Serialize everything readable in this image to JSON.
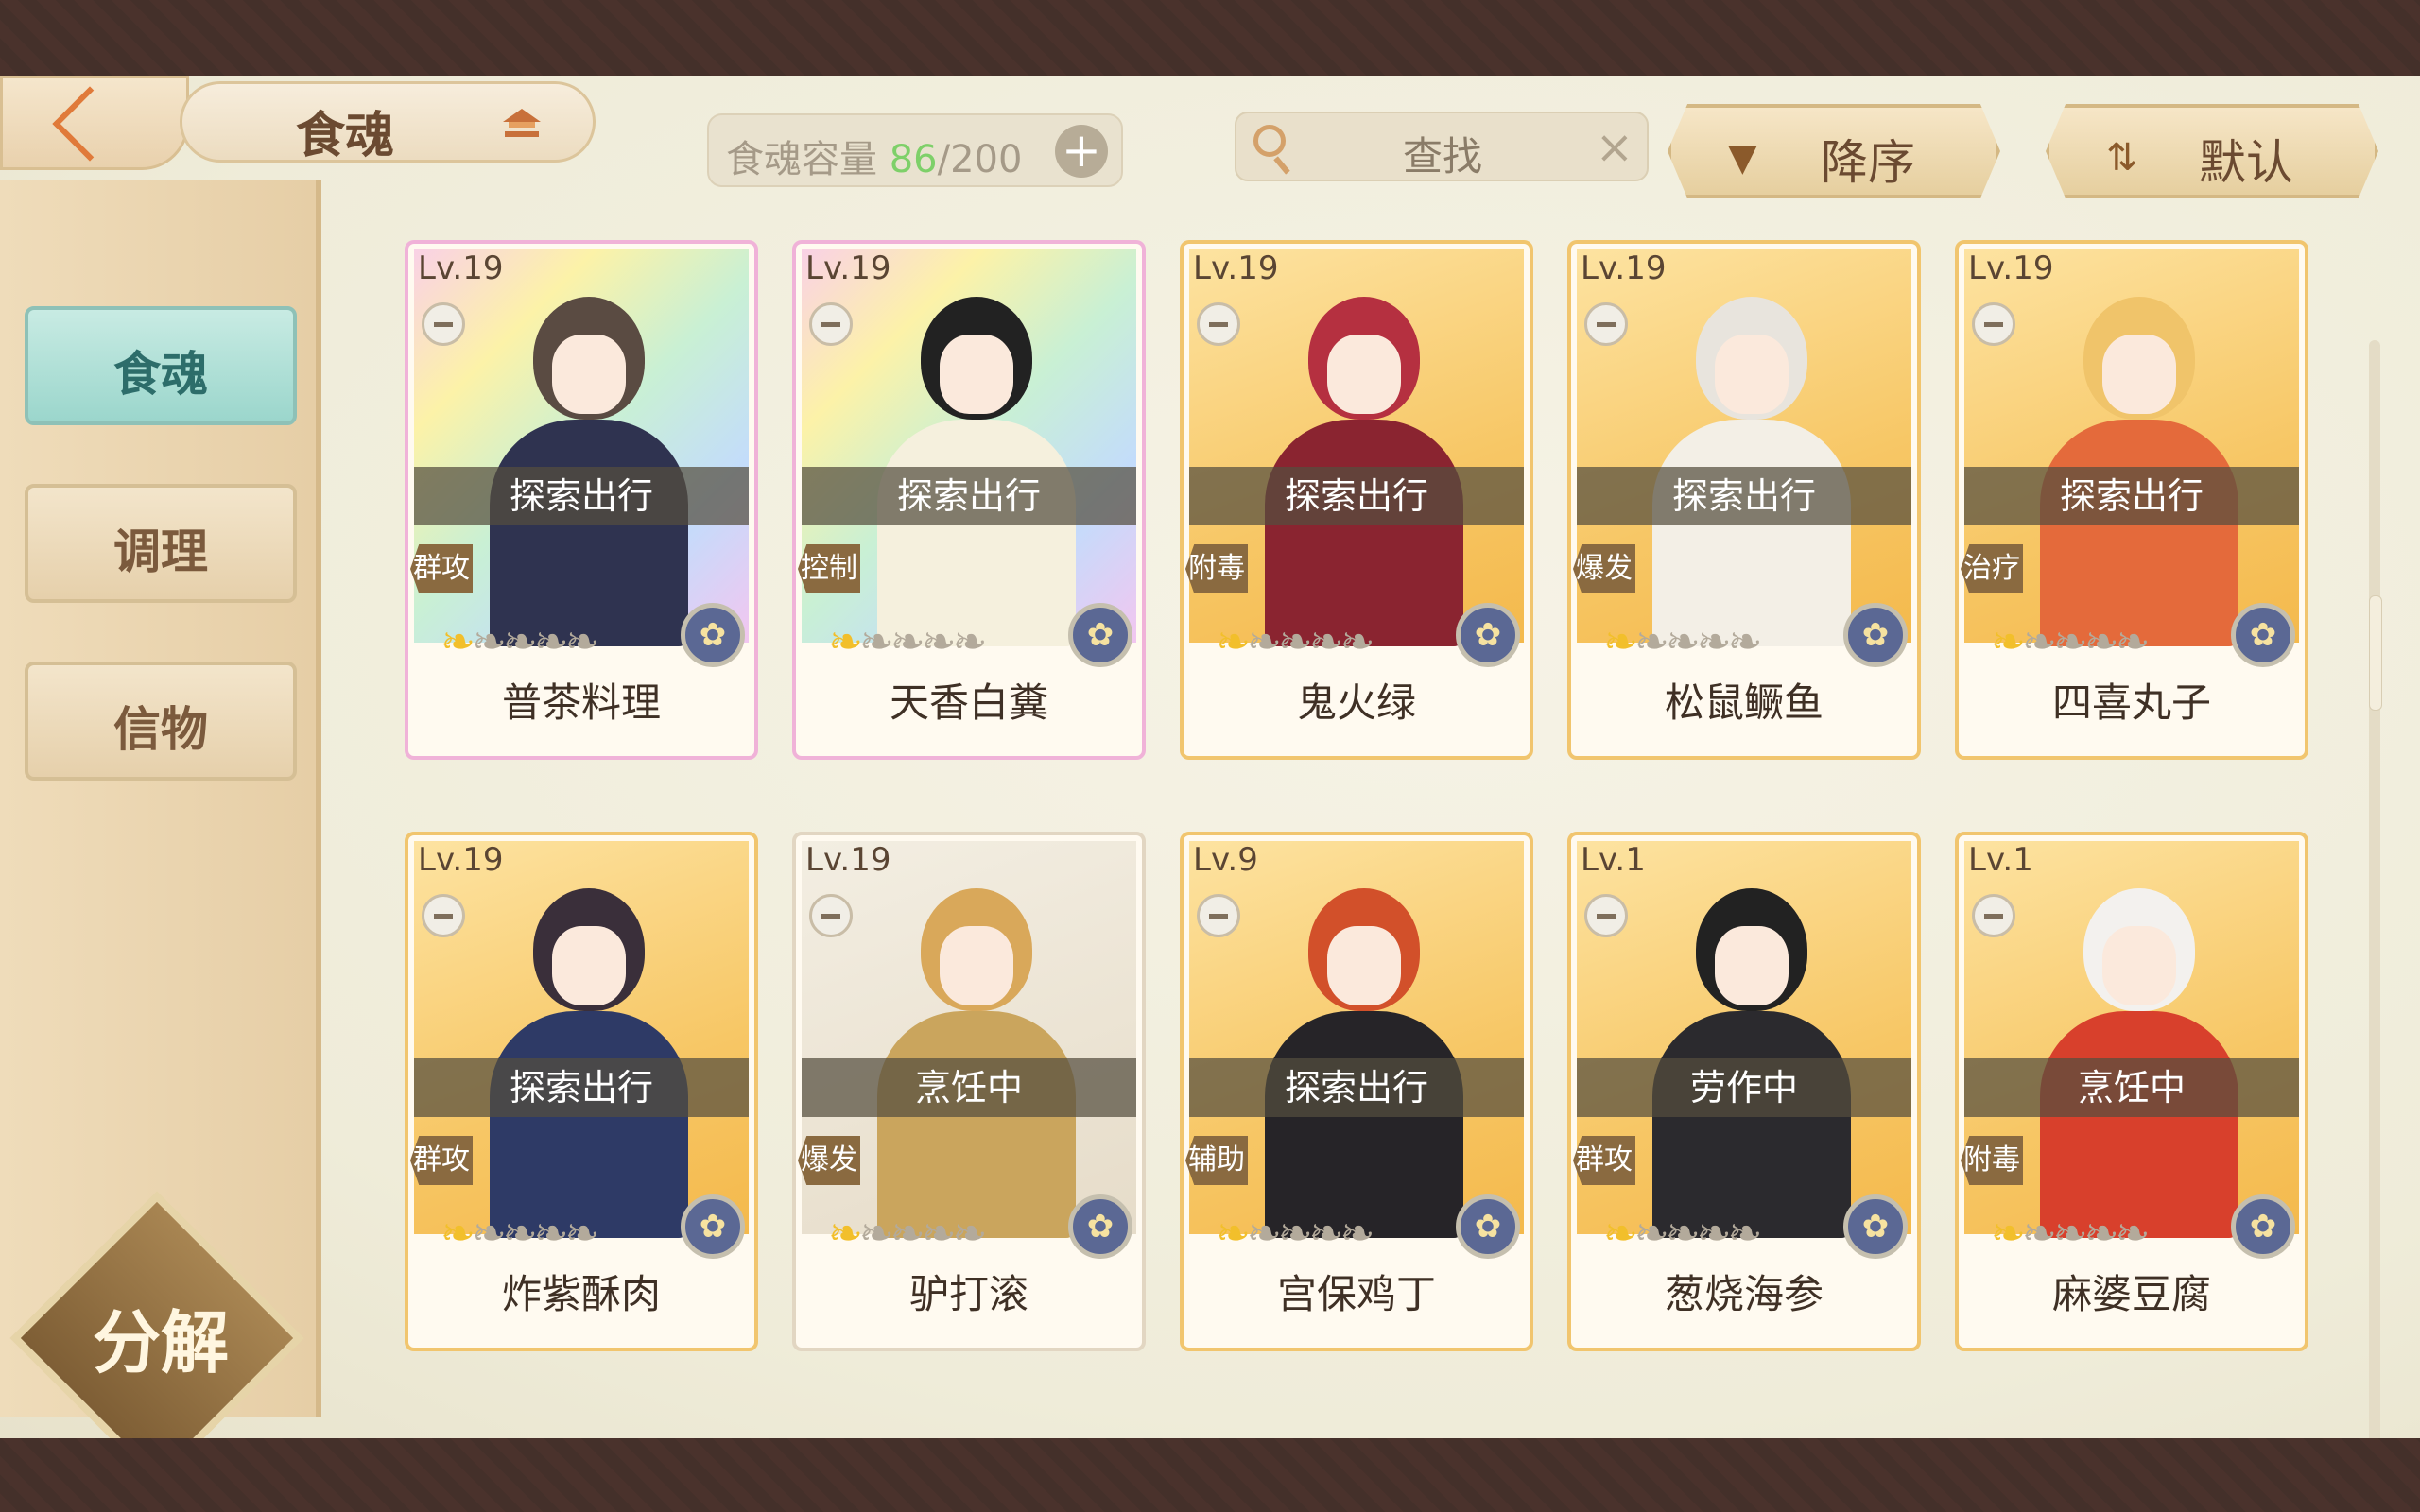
{
  "header": {
    "title": "食魂",
    "capacity_label": "食魂容量",
    "capacity_current": "86",
    "capacity_max": "/200",
    "add_label": "+",
    "search_placeholder": "查找",
    "search_clear": "×",
    "sort_order_label": "降序",
    "sort_mode_label": "默认"
  },
  "sidebar": {
    "items": [
      {
        "label": "食魂",
        "active": true
      },
      {
        "label": "调理",
        "active": false
      },
      {
        "label": "信物",
        "active": false
      }
    ],
    "decompose_label": "分解"
  },
  "cards": [
    {
      "level": "Lv.19",
      "status": "探索出行",
      "tag": "群攻",
      "name": "普茶料理",
      "rarity": "rainbow",
      "stars_on": 1,
      "hair": "#5a4b42",
      "outfit": "#2f3350"
    },
    {
      "level": "Lv.19",
      "status": "探索出行",
      "tag": "控制",
      "name": "天香白糞",
      "rarity": "rainbow",
      "stars_on": 1,
      "hair": "#222",
      "outfit": "#f5f0dd"
    },
    {
      "level": "Lv.19",
      "status": "探索出行",
      "tag": "附毒",
      "name": "鬼火绿",
      "rarity": "gold",
      "stars_on": 1,
      "hair": "#b53040",
      "outfit": "#8a2430"
    },
    {
      "level": "Lv.19",
      "status": "探索出行",
      "tag": "爆发",
      "name": "松鼠鳜鱼",
      "rarity": "gold",
      "stars_on": 1,
      "hair": "#e8e4dd",
      "outfit": "#f3efe6"
    },
    {
      "level": "Lv.19",
      "status": "探索出行",
      "tag": "治疗",
      "name": "四喜丸子",
      "rarity": "gold",
      "stars_on": 1,
      "hair": "#f0c46a",
      "outfit": "#e46a3b"
    },
    {
      "level": "Lv.19",
      "status": "探索出行",
      "tag": "群攻",
      "name": "炸紫酥肉",
      "rarity": "gold",
      "stars_on": 1,
      "hair": "#3a2f3a",
      "outfit": "#2e3a66"
    },
    {
      "level": "Lv.19",
      "status": "烹饪中",
      "tag": "爆发",
      "name": "驴打滚",
      "rarity": "plain",
      "stars_on": 1,
      "hair": "#d9a85a",
      "outfit": "#caa55d"
    },
    {
      "level": "Lv.9",
      "status": "探索出行",
      "tag": "辅助",
      "name": "宫保鸡丁",
      "rarity": "gold",
      "stars_on": 1,
      "hair": "#d2502a",
      "outfit": "#262428"
    },
    {
      "level": "Lv.1",
      "status": "劳作中",
      "tag": "群攻",
      "name": "葱烧海参",
      "rarity": "gold",
      "stars_on": 1,
      "hair": "#222",
      "outfit": "#2b2a2e"
    },
    {
      "level": "Lv.1",
      "status": "烹饪中",
      "tag": "附毒",
      "name": "麻婆豆腐",
      "rarity": "gold",
      "stars_on": 1,
      "hair": "#f3f1ee",
      "outfit": "#d8402c"
    }
  ],
  "colors": {
    "accent": "#e07a3a",
    "active_tab": "#9bd6cc",
    "capacity_number": "#7ed069"
  }
}
